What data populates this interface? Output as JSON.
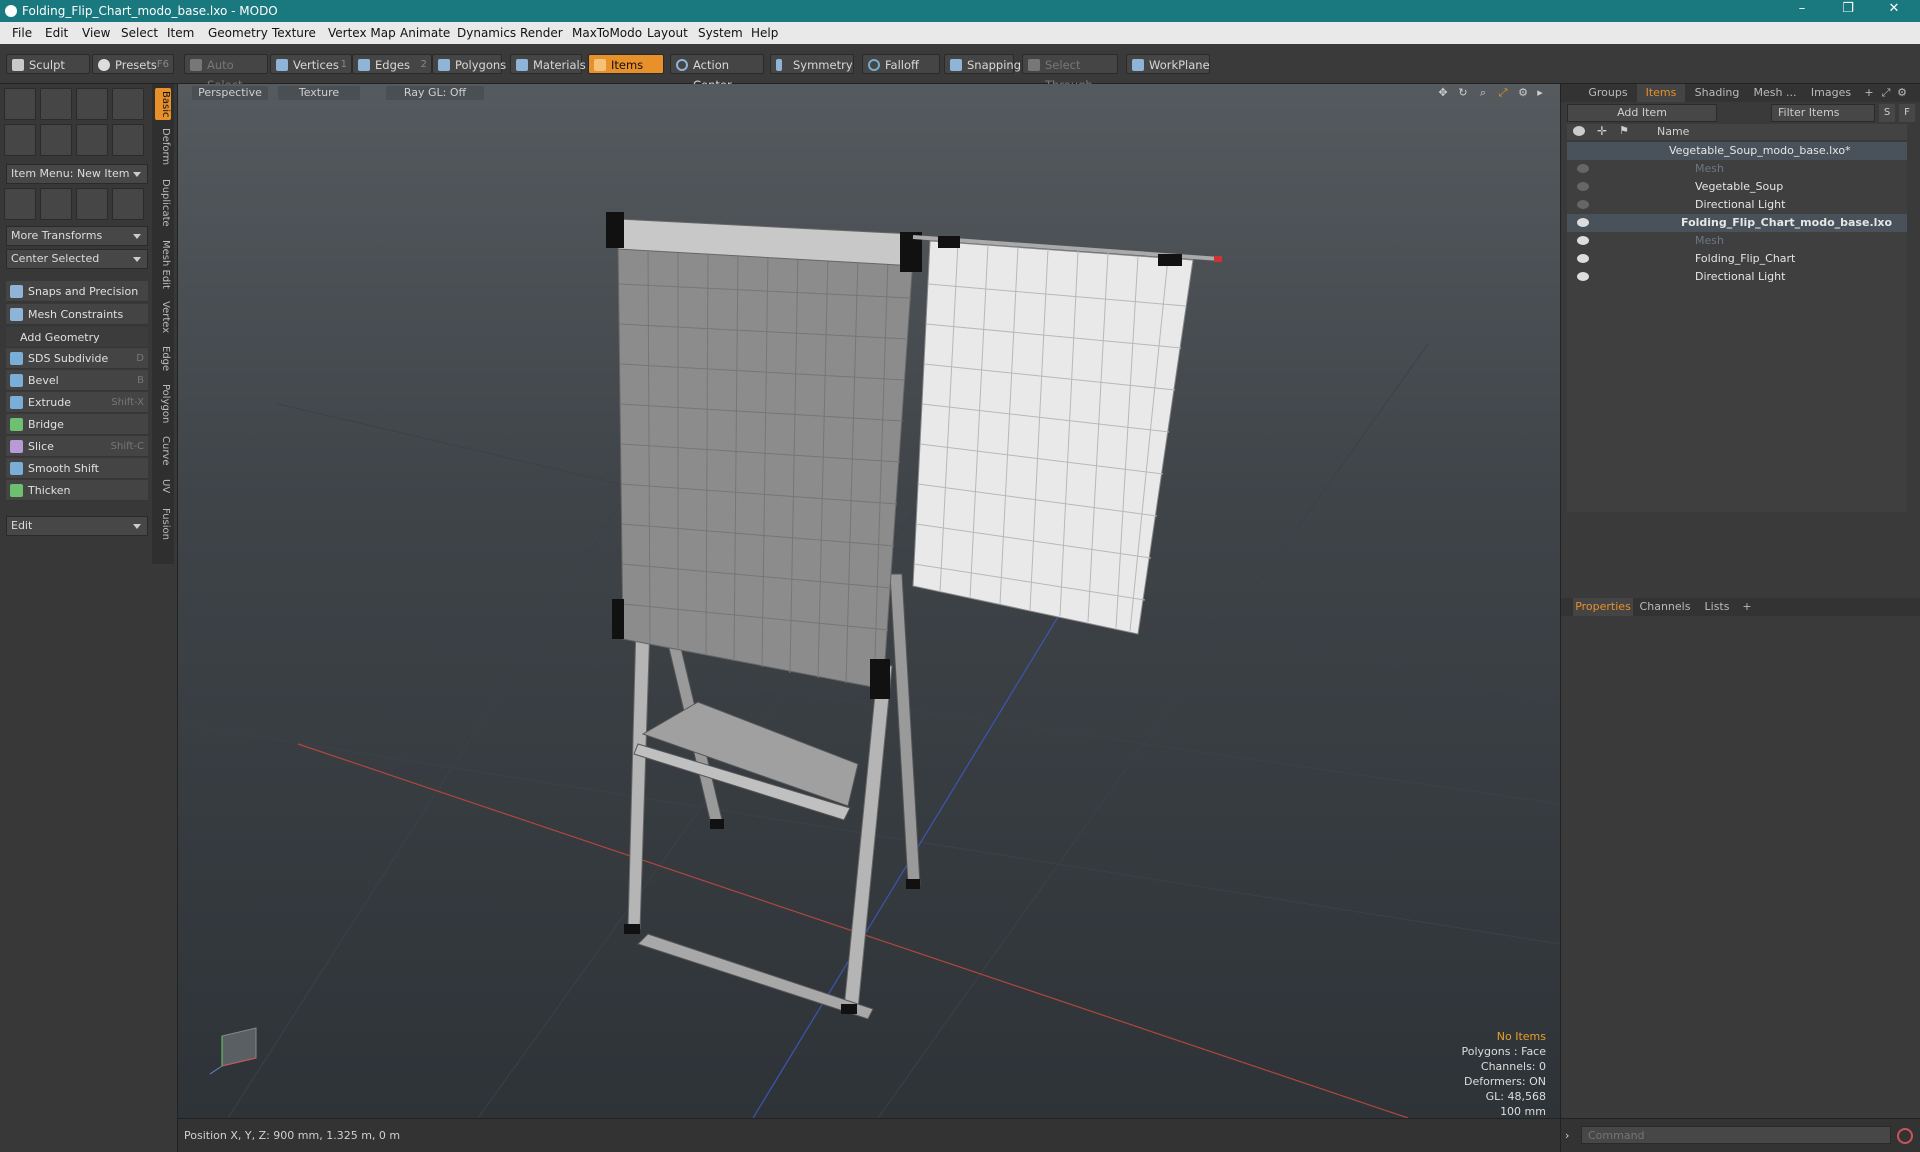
{
  "window": {
    "title": "Folding_Flip_Chart_modo_base.lxo - MODO",
    "controls": [
      "–",
      "❐",
      "✕"
    ]
  },
  "menu": [
    "File",
    "Edit",
    "View",
    "Select",
    "Item",
    "Geometry",
    "Texture",
    "Vertex Map",
    "Animate",
    "Dynamics",
    "Render",
    "MaxToModo",
    "Layout",
    "System",
    "Help"
  ],
  "toolbar": {
    "sculpt": "Sculpt",
    "presets": "Presets",
    "presets_key": "F6",
    "auto_select": "Auto Select",
    "vertices": "Vertices",
    "vertices_key": "1",
    "edges": "Edges",
    "edges_key": "2",
    "polygons": "Polygons",
    "materials": "Materials",
    "items": "Items",
    "action_center": "Action Center",
    "symmetry": "Symmetry",
    "falloff": "Falloff",
    "snapping": "Snapping",
    "select_through": "Select Through",
    "workplane": "WorkPlane"
  },
  "left": {
    "item_menu": "Item Menu: New Item",
    "more_transforms": "More Transforms",
    "center_selected": "Center Selected",
    "snaps": "Snaps and Precision",
    "mesh_constraints": "Mesh Constraints",
    "add_geometry": "Add Geometry",
    "tools": [
      {
        "label": "SDS Subdivide",
        "key": "D"
      },
      {
        "label": "Bevel",
        "key": "B"
      },
      {
        "label": "Extrude",
        "key": "Shift-X"
      },
      {
        "label": "Bridge",
        "key": ""
      },
      {
        "label": "Slice",
        "key": "Shift-C"
      },
      {
        "label": "Smooth Shift",
        "key": ""
      },
      {
        "label": "Thicken",
        "key": ""
      }
    ],
    "edit": "Edit",
    "side_tabs": [
      "Basic",
      "Deform",
      "Duplicate",
      "Mesh Edit",
      "Vertex",
      "Edge",
      "Polygon",
      "Curve",
      "UV",
      "Fusion"
    ]
  },
  "viewport": {
    "perspective": "Perspective",
    "texture": "Texture",
    "raygl": "Ray GL: Off",
    "info": {
      "no_items": "No Items",
      "polygons": "Polygons : Face",
      "channels": "Channels: 0",
      "deformers": "Deformers: ON",
      "gl": "GL: 48,568",
      "scale": "100 mm"
    }
  },
  "status": {
    "position": "Position X, Y, Z:  900 mm, 1.325 m, 0 m"
  },
  "right": {
    "tabs": [
      "Groups",
      "Items",
      "Shading",
      "Mesh ...",
      "Images"
    ],
    "add_item": "Add Item",
    "filter_items": "Filter Items",
    "filter_s": "S",
    "filter_f": "F",
    "col_name": "Name",
    "tree": [
      {
        "label": "Vegetable_Soup_modo_base.lxo*"
      },
      {
        "label": "Mesh"
      },
      {
        "label": "Vegetable_Soup"
      },
      {
        "label": "Directional Light"
      },
      {
        "label": "Folding_Flip_Chart_modo_base.lxo"
      },
      {
        "label": "Mesh"
      },
      {
        "label": "Folding_Flip_Chart"
      },
      {
        "label": "Directional Light"
      }
    ],
    "bottom_tabs": [
      "Properties",
      "Channels",
      "Lists"
    ],
    "command_placeholder": "Command"
  }
}
